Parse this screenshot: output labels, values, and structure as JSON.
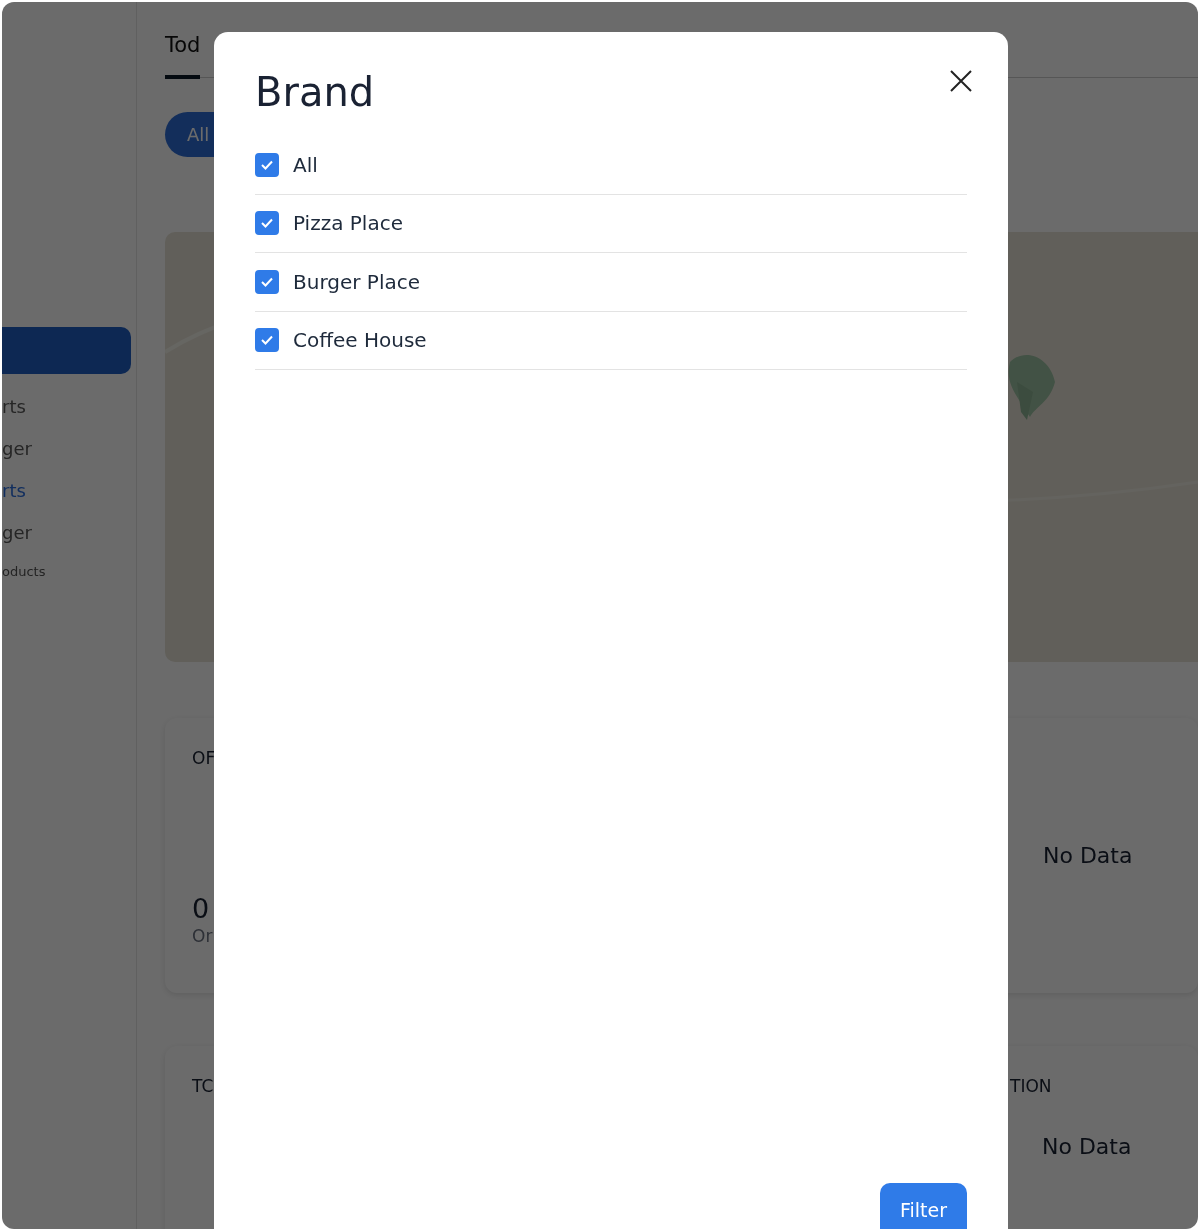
{
  "page": {
    "tabs": [
      {
        "label": "Tod",
        "selected": true
      }
    ],
    "filter_chip": {
      "label": "All",
      "selected": true
    },
    "sidebar": {
      "items": [
        {
          "kind": "active-bar"
        },
        {
          "kind": "item",
          "label": "rts"
        },
        {
          "kind": "item",
          "label": "ger"
        },
        {
          "kind": "current",
          "label": "rts"
        },
        {
          "kind": "item",
          "label": "ger"
        },
        {
          "kind": "section",
          "label": "oducts"
        }
      ]
    },
    "cards": [
      {
        "title": "OF",
        "value": "0",
        "caption": "Or",
        "message": "No Data"
      },
      {
        "title": "TC",
        "title_right": "TION",
        "message": "No Data"
      }
    ]
  },
  "modal": {
    "title": "Brand",
    "options": [
      {
        "label": "All",
        "checked": true
      },
      {
        "label": "Pizza Place",
        "checked": true
      },
      {
        "label": "Burger Place",
        "checked": true
      },
      {
        "label": "Coffee House",
        "checked": true
      }
    ],
    "button": "Filter"
  }
}
